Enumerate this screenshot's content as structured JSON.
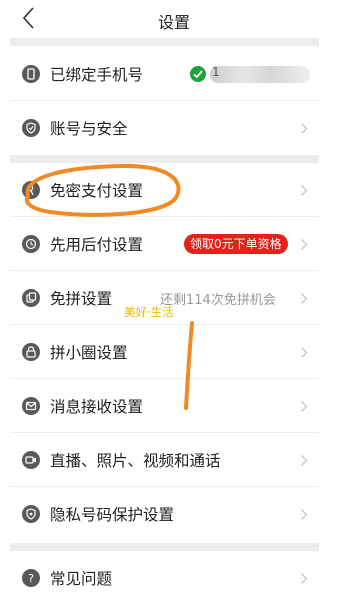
{
  "header": {
    "title": "设置"
  },
  "sections": [
    {
      "items": [
        {
          "label": "已绑定手机号",
          "icon": "phone-icon",
          "phone_visible": "1"
        },
        {
          "label": "账号与安全",
          "icon": "shield-check-icon"
        }
      ]
    },
    {
      "items": [
        {
          "label": "免密支付设置",
          "icon": "key-icon"
        },
        {
          "label": "先用后付设置",
          "icon": "pay-later-icon",
          "badge": "领取0元下单资格"
        },
        {
          "label": "免拼设置",
          "icon": "group-buy-icon",
          "hint": "还剩114次免拼机会"
        },
        {
          "label": "拼小圈设置",
          "icon": "lock-icon"
        },
        {
          "label": "消息接收设置",
          "icon": "mail-icon"
        },
        {
          "label": "直播、照片、视频和通话",
          "icon": "video-icon"
        },
        {
          "label": "隐私号码保护设置",
          "icon": "privacy-icon"
        }
      ]
    },
    {
      "items": [
        {
          "label": "常见问题",
          "icon": "question-icon"
        }
      ]
    }
  ],
  "watermark": "美好·生活",
  "colors": {
    "badge_bg": "#e2231a",
    "check_green": "#19a538",
    "annotation_orange": "#f08a24",
    "section_gap": "#ececec"
  }
}
